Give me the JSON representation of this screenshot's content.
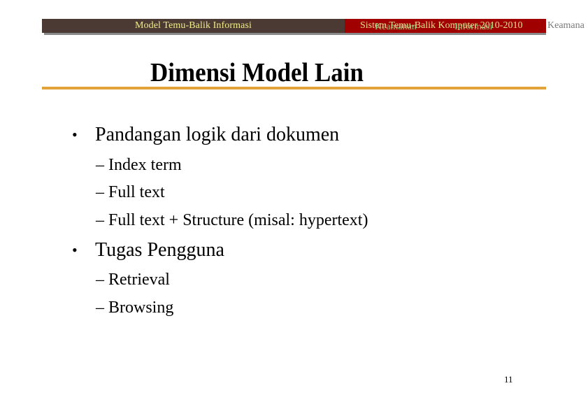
{
  "header": {
    "left_label": "Model Temu-Balik Informasi",
    "right_label_primary": "Sistem Temu-Balik Komputer 2010-2010",
    "right_label_overlay_1": "Keamanan",
    "right_label_overlay_2": "Informasi",
    "right_label_overflow": "Keamana",
    "colors": {
      "left_bar": "#4a3a33",
      "right_bar": "#a00000",
      "left_text": "#f2ec8c",
      "overlay_text": "#8fe08c"
    }
  },
  "slide": {
    "title": "Dimensi Model Lain",
    "rule_color": "#e2a33a",
    "bullets": [
      {
        "text": "Pandangan logik dari dokumen",
        "subitems": [
          "– Index term",
          "– Full text",
          "– Full text + Structure (misal: hypertext)"
        ]
      },
      {
        "text": "Tugas Pengguna",
        "subitems": [
          "– Retrieval",
          "– Browsing"
        ]
      }
    ],
    "bullet_glyph": "•",
    "page_number": "11"
  }
}
